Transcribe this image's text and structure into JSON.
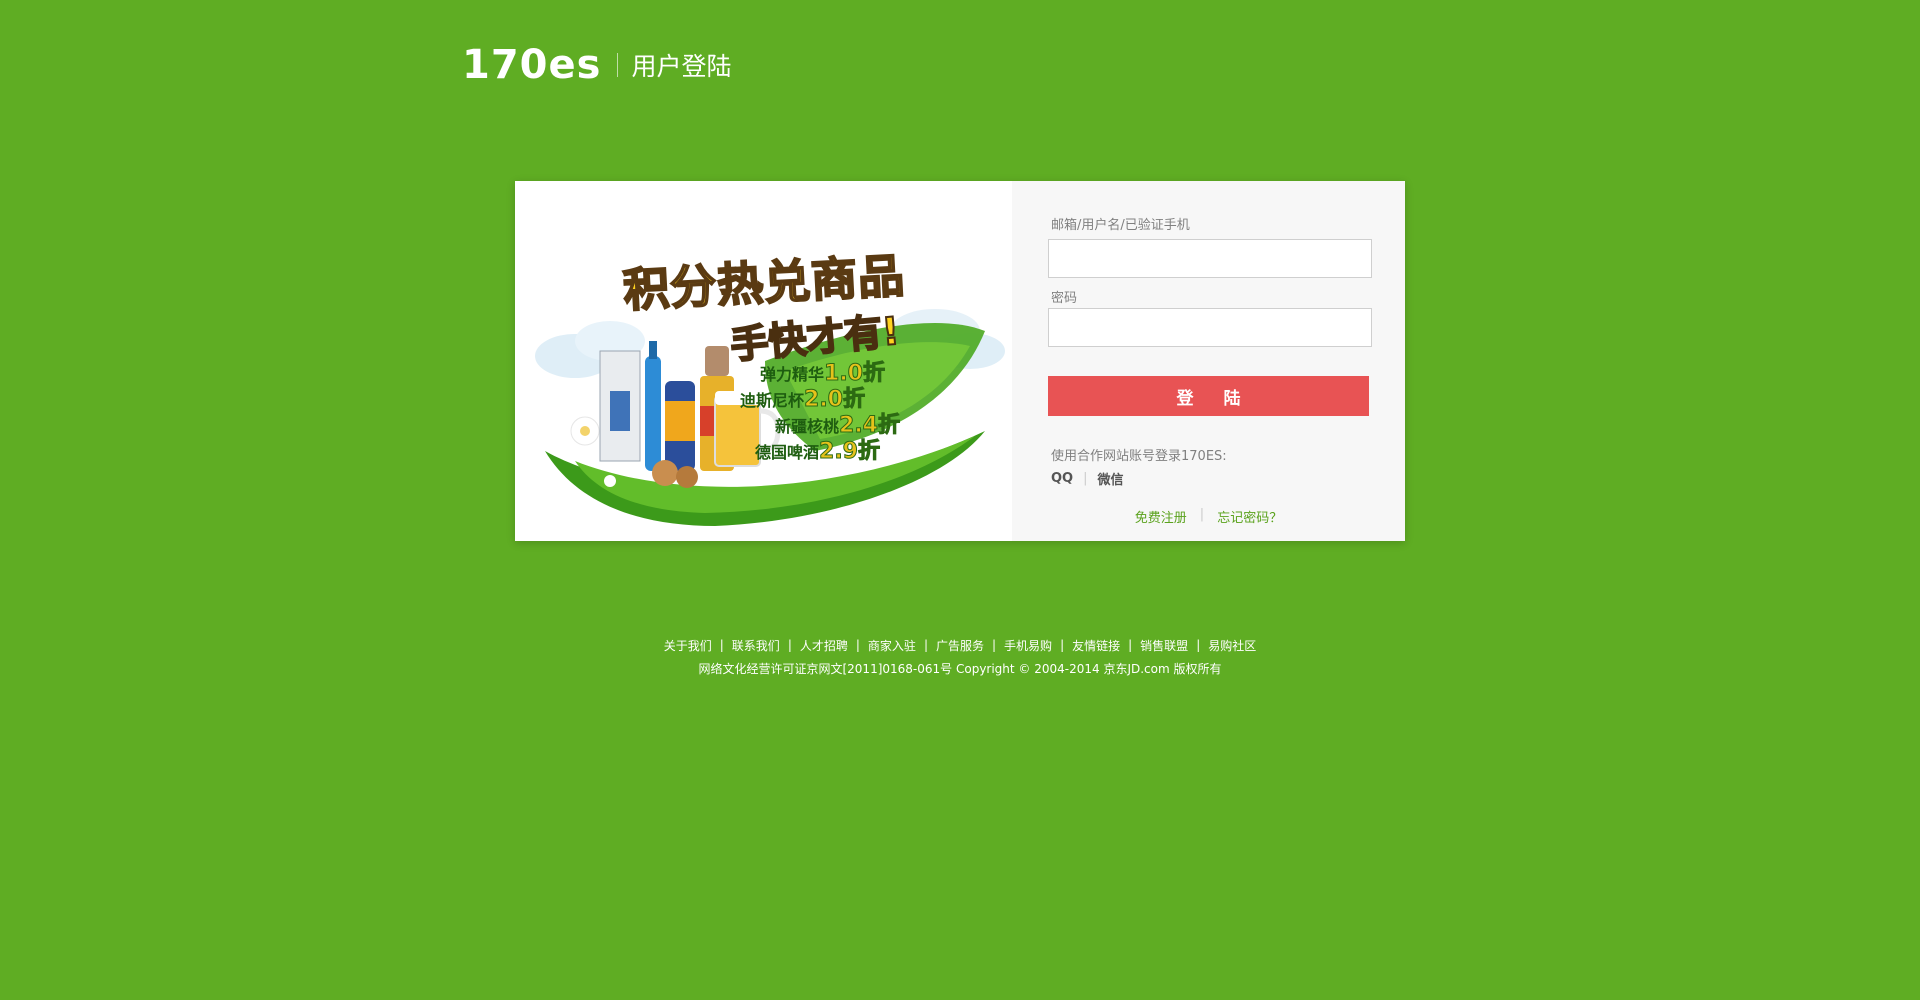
{
  "header": {
    "logo": "170es",
    "title": "用户登陆"
  },
  "promo": {
    "headline": "积分热兑商品",
    "subheadline": "手快才有!",
    "offers": [
      {
        "name": "弹力精华",
        "discount": "1.0折"
      },
      {
        "name": "迪斯尼杯",
        "discount": "2.0折"
      },
      {
        "name": "新疆核桃",
        "discount": "2.4折"
      },
      {
        "name": "德国啤酒",
        "discount": "2.9折"
      }
    ]
  },
  "form": {
    "username_label": "邮箱/用户名/已验证手机",
    "username_value": "",
    "password_label": "密码",
    "password_value": "",
    "login_button": "登 陆",
    "partner_text": "使用合作网站账号登录170ES:",
    "partners": [
      "QQ",
      "微信"
    ],
    "register_link": "免费注册",
    "forgot_link": "忘记密码？"
  },
  "footer": {
    "links": [
      "关于我们",
      "联系我们",
      "人才招聘",
      "商家入驻",
      "广告服务",
      "手机易购",
      "友情链接",
      "销售联盟",
      "易购社区"
    ],
    "copyright": "网络文化经营许可证京网文[2011]0168-061号  Copyright © 2004-2014  京东JD.com 版权所有"
  },
  "colors": {
    "background": "#5fad23",
    "button": "#e85354",
    "link": "#5aa21c"
  }
}
